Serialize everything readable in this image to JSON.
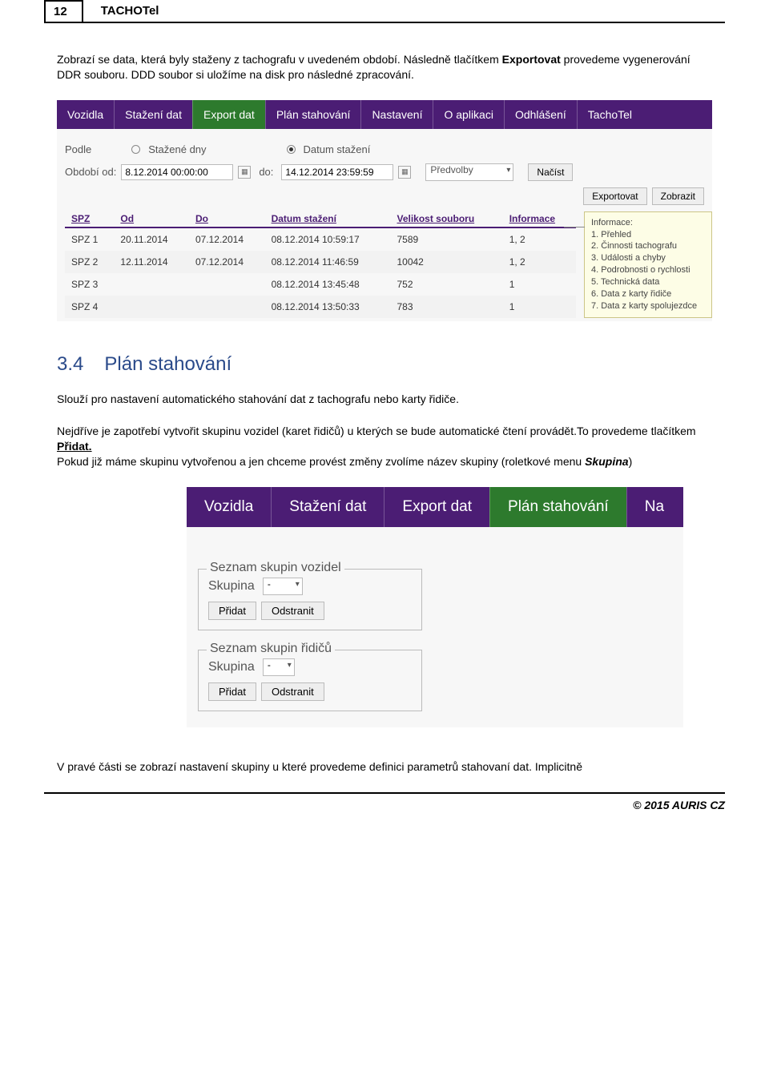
{
  "page": {
    "number": "12",
    "title": "TACHOTel"
  },
  "intro": {
    "text1": "Zobrazí se data, která byly staženy z tachografu v uvedeném období. Následně tlačítkem ",
    "bold1": "Exportovat",
    "text2": " provedeme vygenerování DDR souboru. DDD soubor si uložíme na disk pro následné zpracování."
  },
  "nav1": [
    "Vozidla",
    "Stažení dat",
    "Export dat",
    "Plán stahování",
    "Nastavení",
    "O aplikaci",
    "Odhlášení",
    "TachoTel"
  ],
  "nav1_active": 2,
  "filter": {
    "podle": "Podle",
    "opt1": "Stažené dny",
    "opt2": "Datum stažení",
    "obdobi_od": "Období od:",
    "from": "8.12.2014 00:00:00",
    "do": "do:",
    "to": "14.12.2014 23:59:59",
    "predvolby": "Předvolby",
    "nacist": "Načíst",
    "exportovat": "Exportovat",
    "zobrazit": "Zobrazit"
  },
  "table": {
    "headers": [
      "SPZ",
      "Od",
      "Do",
      "Datum stažení",
      "Velikost souboru",
      "Informace"
    ],
    "rows": [
      [
        "SPZ 1",
        "20.11.2014",
        "07.12.2014",
        "08.12.2014 10:59:17",
        "7589",
        "1, 2"
      ],
      [
        "SPZ 2",
        "12.11.2014",
        "07.12.2014",
        "08.12.2014 11:46:59",
        "10042",
        "1, 2"
      ],
      [
        "SPZ 3",
        "",
        "",
        "08.12.2014 13:45:48",
        "752",
        "1"
      ],
      [
        "SPZ 4",
        "",
        "",
        "08.12.2014 13:50:33",
        "783",
        "1"
      ]
    ]
  },
  "tooltip": {
    "title": "Informace:",
    "items": [
      "1. Přehled",
      "2. Činnosti tachografu",
      "3. Události a chyby",
      "4. Podrobnosti o rychlosti",
      "5. Technická data",
      "6. Data z karty řidiče",
      "7. Data z karty spolujezdce"
    ]
  },
  "section": {
    "num": "3.4",
    "title": "Plán stahování"
  },
  "para2": "Slouží pro nastavení automatického stahování dat z tachografu nebo karty řidiče.",
  "para3": {
    "t1": "Nejdříve je zapotřebí vytvořit skupinu vozidel (karet řidičů) u kterých se bude automatické čtení provádět.To provedeme tlačítkem ",
    "b1": "Přidat.",
    "t2": "Pokud již máme skupinu vytvořenou a jen chceme provést změny zvolíme název skupiny  (roletkové menu ",
    "b2": "Skupina",
    "t3": ")"
  },
  "nav2": [
    "Vozidla",
    "Stažení dat",
    "Export dat",
    "Plán stahování",
    "Na"
  ],
  "nav2_active": 3,
  "fs1": {
    "legend": "Seznam skupin vozidel",
    "label": "Skupina",
    "value": "-",
    "add": "Přidat",
    "remove": "Odstranit"
  },
  "fs2": {
    "legend": "Seznam skupin řidičů",
    "label": "Skupina",
    "value": "-",
    "add": "Přidat",
    "remove": "Odstranit"
  },
  "last": "V pravé části se zobrazí nastavení skupiny u které provedeme definici parametrů stahovaní dat. Implicitně",
  "footer": "© 2015 AURIS CZ"
}
